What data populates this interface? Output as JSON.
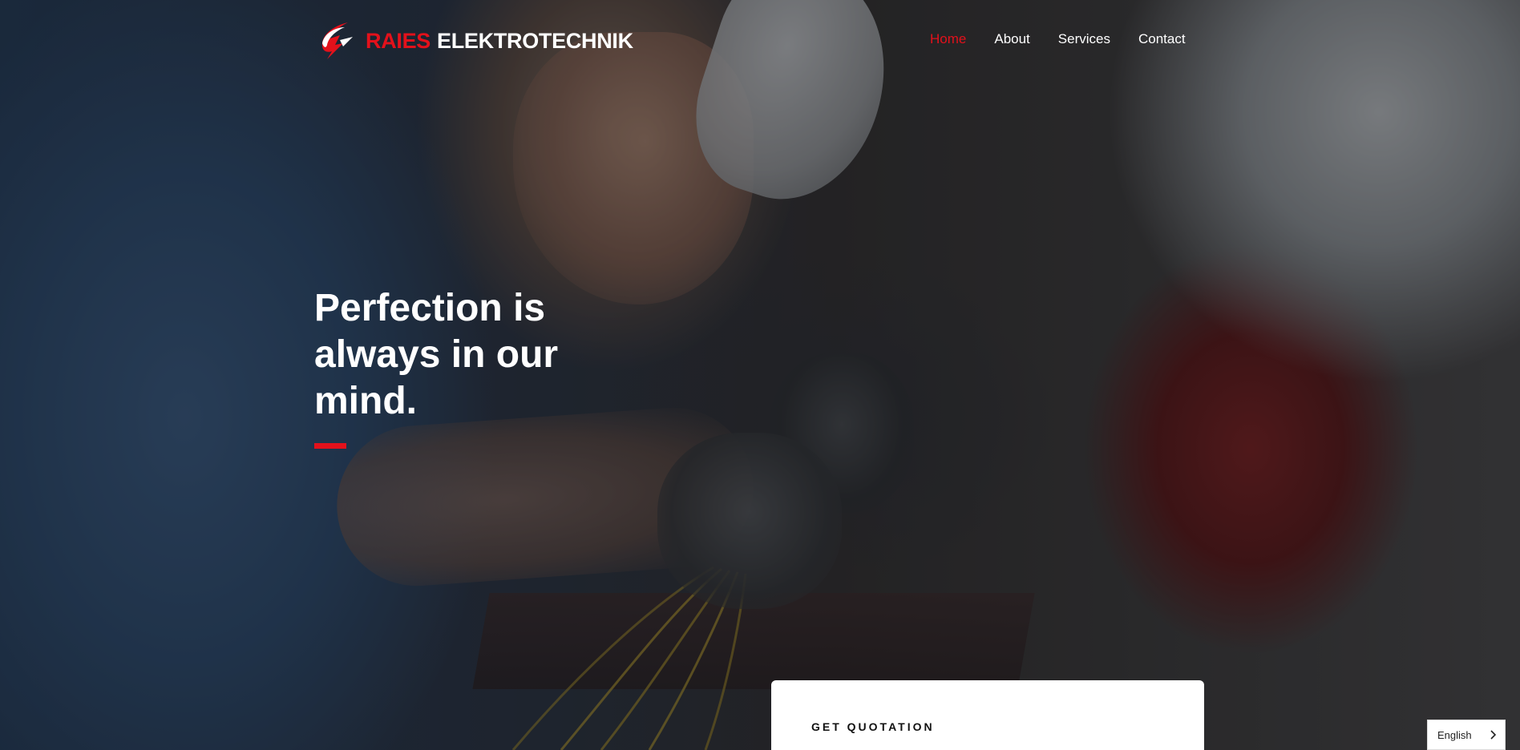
{
  "brand": {
    "name_part1": "RAIES",
    "name_part2": "ELEKTROTECHNIK",
    "logo_icon": "lightning-bolt-icon",
    "accent_color": "#e3111b"
  },
  "nav": {
    "items": [
      {
        "label": "Home",
        "active": true
      },
      {
        "label": "About",
        "active": false
      },
      {
        "label": "Services",
        "active": false
      },
      {
        "label": "Contact",
        "active": false
      }
    ]
  },
  "hero": {
    "headline": "Perfection is always in our mind."
  },
  "quote_card": {
    "title": "GET QUOTATION"
  },
  "language_selector": {
    "selected": "English",
    "icon": "chevron-right-icon"
  }
}
